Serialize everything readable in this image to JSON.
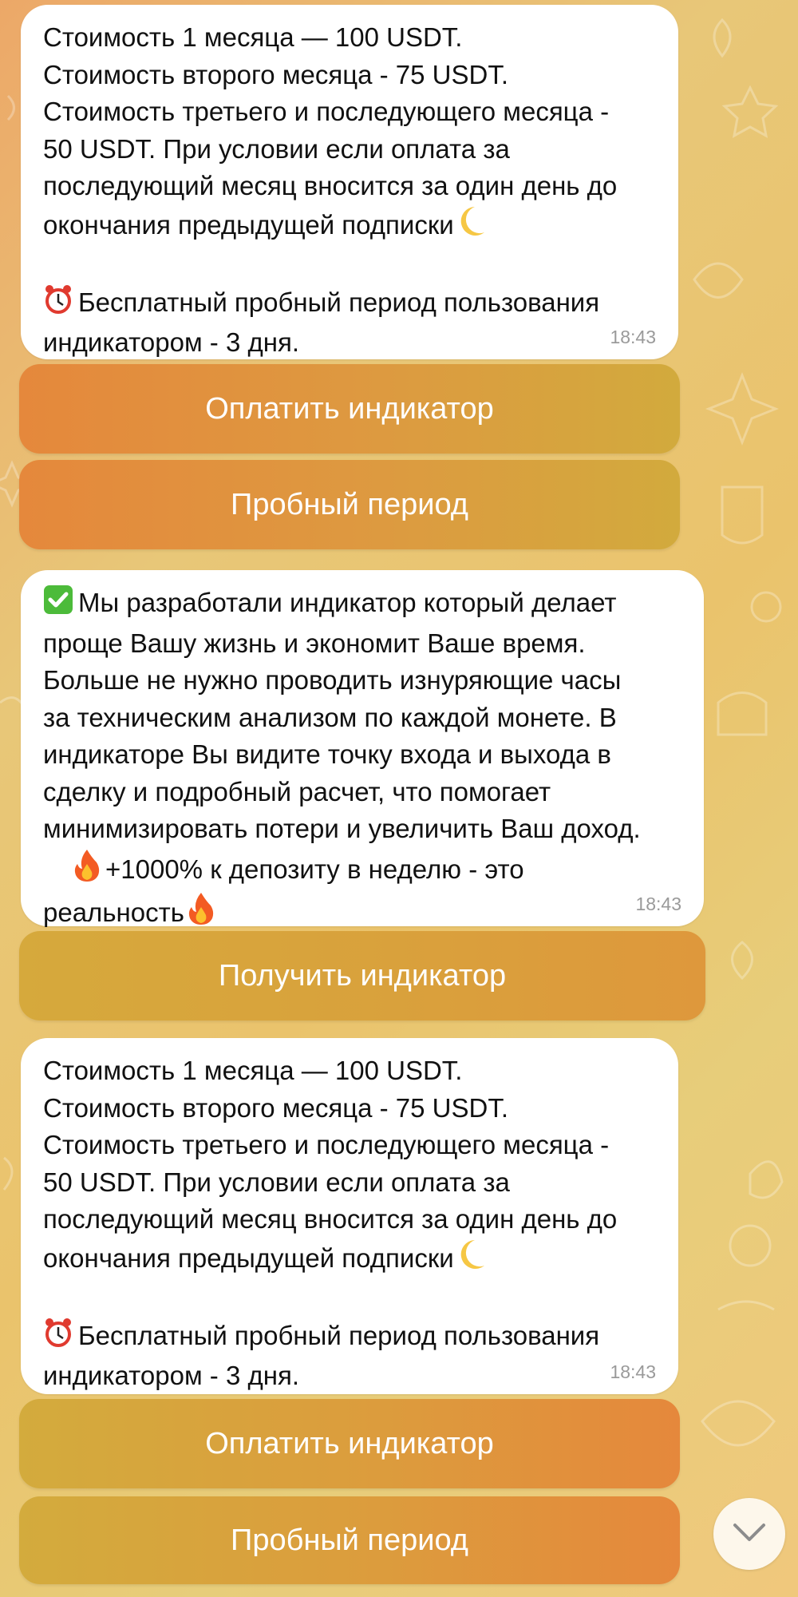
{
  "chat": {
    "messages": [
      {
        "lines": [
          "Стоимость 1 месяца — 100 USDT.",
          "Стоимость второго месяца - 75 USDT.",
          "Стоимость третьего и последующего месяца -",
          "50 USDT. При условии если оплата за",
          "последующий месяц вносится за один день до",
          "окончания предыдущей подписки",
          "",
          "Бесплатный пробный период пользования",
          "индикатором - 3 дня."
        ],
        "time": "18:43"
      },
      {
        "lines": [
          "Мы разработали индикатор который делает",
          "проще Вашу жизнь и экономит Ваше время.",
          "Больше не нужно проводить изнуряющие часы",
          "за техническим анализом по каждой монете. В",
          "индикаторе Вы видите точку входа и выхода в",
          "сделку и подробный расчет, что помогает",
          "минимизировать потери и увеличить Ваш доход.",
          "+1000% к депозиту в неделю - это",
          "реальность"
        ],
        "time": "18:43"
      },
      {
        "lines": [
          "Стоимость 1 месяца — 100 USDT.",
          "Стоимость второго месяца - 75 USDT.",
          "Стоимость третьего и последующего месяца -",
          "50 USDT. При условии если оплата за",
          "последующий месяц вносится за один день до",
          "окончания предыдущей подписки",
          "",
          "Бесплатный пробный период пользования",
          "индикатором - 3 дня."
        ],
        "time": "18:43"
      }
    ],
    "buttons": {
      "pay_1": "Оплатить индикатор",
      "trial_1": "Пробный период",
      "get": "Получить индикатор",
      "pay_2": "Оплатить индикатор",
      "trial_2": "Пробный период"
    },
    "icons": {
      "moon": "crescent-moon-emoji",
      "alarm": "alarm-clock-emoji",
      "check": "check-mark-emoji",
      "fire": "fire-emoji",
      "scroll": "chevron-down-icon"
    },
    "colors": {
      "button_orange": "#e5883c",
      "button_gold": "#d2aa3d",
      "bubble": "#ffffff",
      "time": "#9a9a9a"
    }
  }
}
